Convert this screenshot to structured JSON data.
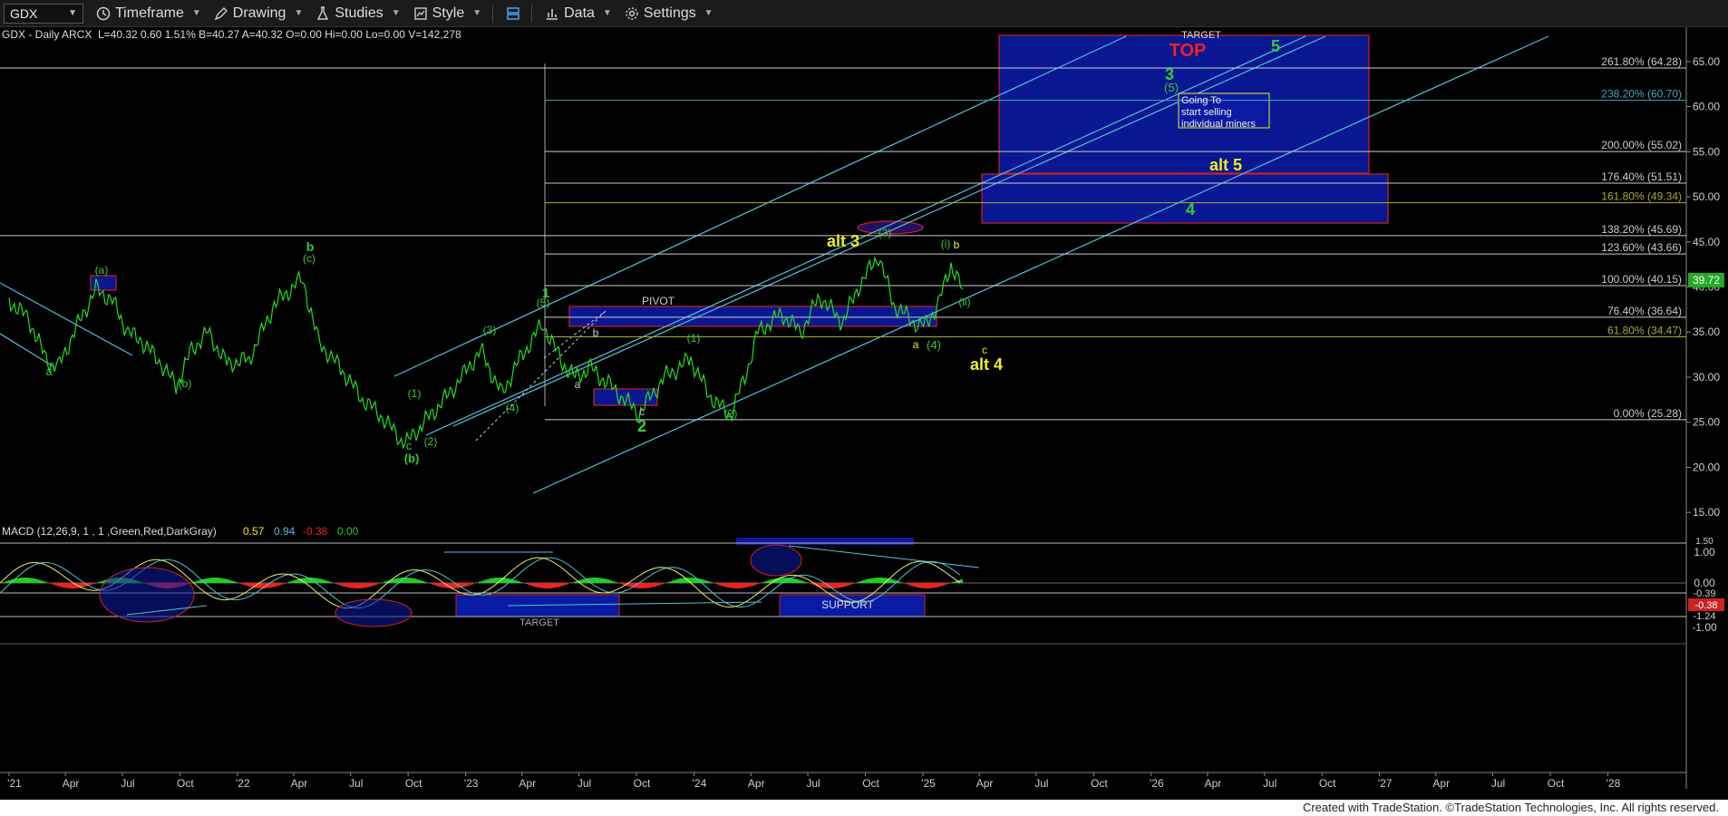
{
  "toolbar": {
    "symbol": "GDX",
    "timeframe": "Timeframe",
    "drawing": "Drawing",
    "studies": "Studies",
    "style": "Style",
    "data": "Data",
    "settings": "Settings"
  },
  "header": {
    "title": "GDX - Daily  ARCX",
    "stats": "L=40.32  0.60  1.51%  B=40.27  A=40.32  O=0.00  Hi=0.00  Lo=0.00  V=142,278"
  },
  "macd": {
    "label": "MACD (12,26,9, 1 , 1 ,Green,Red,DarkGray)",
    "v1": "0.57",
    "v2": "0.94",
    "v3": "-0.38",
    "v4": "0.00",
    "y_ticks": [
      "1.50",
      "1.00",
      "0.00",
      "-0.39",
      "-0.38",
      "-1.24",
      "-1.00"
    ],
    "support_label": "SUPPORT",
    "target_label": "TARGET"
  },
  "colors": {
    "price": "#22dd22",
    "fib": "#cccccc",
    "channel": "#4fc3d8",
    "box_fill": "#0b1aa3",
    "box_border": "#cc2222",
    "wave_green": "#33cc33",
    "wave_yellow": "#eeee22",
    "macd_hist_pos": "#22cc22",
    "macd_hist_neg": "#ee2222"
  },
  "chart_data": {
    "type": "line",
    "title": "GDX - Daily",
    "y_axis": {
      "min": 12,
      "max": 68,
      "ticks": [
        15,
        20,
        25,
        30,
        35,
        40,
        45,
        50,
        55,
        60,
        65
      ]
    },
    "x_labels": [
      "'21",
      "Apr",
      "Jul",
      "Oct",
      "'22",
      "Apr",
      "Jul",
      "Oct",
      "'23",
      "Apr",
      "Jul",
      "Oct",
      "'24",
      "Apr",
      "Jul",
      "Oct",
      "'25",
      "Apr",
      "Jul",
      "Oct",
      "'26",
      "Apr",
      "Jul",
      "Oct",
      "'27",
      "Apr",
      "Jul",
      "Oct",
      "'28"
    ],
    "last_price": 39.72,
    "price_series": [
      [
        "2021-01-01",
        38.5
      ],
      [
        "2021-02-01",
        36.5
      ],
      [
        "2021-03-01",
        32.0
      ],
      [
        "2021-03-20",
        31.0
      ],
      [
        "2021-04-15",
        35.0
      ],
      [
        "2021-05-20",
        39.8
      ],
      [
        "2021-06-15",
        38.5
      ],
      [
        "2021-07-10",
        35.0
      ],
      [
        "2021-08-01",
        34.0
      ],
      [
        "2021-09-01",
        31.5
      ],
      [
        "2021-09-25",
        29.0
      ],
      [
        "2021-10-20",
        33.0
      ],
      [
        "2021-11-15",
        35.0
      ],
      [
        "2021-12-15",
        31.5
      ],
      [
        "2022-01-20",
        32.0
      ],
      [
        "2022-03-01",
        38.0
      ],
      [
        "2022-04-15",
        41.0
      ],
      [
        "2022-05-10",
        34.0
      ],
      [
        "2022-06-15",
        31.0
      ],
      [
        "2022-07-20",
        27.5
      ],
      [
        "2022-08-15",
        26.0
      ],
      [
        "2022-09-26",
        22.5
      ],
      [
        "2022-10-20",
        24.5
      ],
      [
        "2022-11-15",
        26.5
      ],
      [
        "2022-12-10",
        28.5
      ],
      [
        "2023-01-25",
        33.0
      ],
      [
        "2023-02-28",
        28.0
      ],
      [
        "2023-03-20",
        31.0
      ],
      [
        "2023-05-04",
        36.0
      ],
      [
        "2023-06-05",
        31.5
      ],
      [
        "2023-06-25",
        30.0
      ],
      [
        "2023-07-20",
        31.0
      ],
      [
        "2023-08-20",
        29.0
      ],
      [
        "2023-10-05",
        26.0
      ],
      [
        "2023-11-15",
        30.0
      ],
      [
        "2023-12-27",
        32.0
      ],
      [
        "2024-01-25",
        28.0
      ],
      [
        "2024-02-28",
        25.7
      ],
      [
        "2024-03-25",
        30.5
      ],
      [
        "2024-04-12",
        35.0
      ],
      [
        "2024-05-20",
        37.0
      ],
      [
        "2024-06-20",
        35.0
      ],
      [
        "2024-07-20",
        39.0
      ],
      [
        "2024-08-25",
        36.0
      ],
      [
        "2024-09-20",
        40.0
      ],
      [
        "2024-10-22",
        43.5
      ],
      [
        "2024-11-15",
        38.0
      ],
      [
        "2024-12-20",
        36.0
      ],
      [
        "2025-01-02",
        35.5
      ],
      [
        "2025-01-25",
        38.0
      ],
      [
        "2025-02-15",
        42.5
      ],
      [
        "2025-03-05",
        39.72
      ]
    ],
    "fib_levels": [
      {
        "label": "0.00% (25.28)",
        "value": 25.28
      },
      {
        "label": "61.80% (34.47)",
        "value": 34.47
      },
      {
        "label": "76.40% (36.64)",
        "value": 36.64
      },
      {
        "label": "100.00% (40.15)",
        "value": 40.15
      },
      {
        "label": "123.60% (43.66)",
        "value": 43.66
      },
      {
        "label": "138.20% (45.69)",
        "value": 45.69
      },
      {
        "label": "161.80% (49.34)",
        "value": 49.34
      },
      {
        "label": "176.40% (51.51)",
        "value": 51.51
      },
      {
        "label": "200.00% (55.02)",
        "value": 55.02
      },
      {
        "label": "238.20% (60.70)",
        "value": 60.7
      },
      {
        "label": "261.80% (64.28)",
        "value": 64.28
      }
    ],
    "annotations": {
      "pivot": "PIVOT",
      "target": "TARGET",
      "top": "TOP",
      "note": [
        "Going To",
        "start selling",
        "individual miners"
      ],
      "alt3": "alt 3",
      "alt4": "alt 4",
      "alt5": "alt 5",
      "waves": [
        "a",
        "(a)",
        "(b)",
        "b",
        "(c)",
        "c",
        "(b)",
        "(1)",
        "(2)",
        "(3)",
        "(4)",
        "(5)",
        "1",
        "a",
        "b",
        "c",
        "2",
        "(1)",
        "(2)",
        "(3)",
        "(4)",
        "a",
        "(i)",
        "b",
        "(ii)",
        "c",
        "3",
        "(5)",
        "4",
        "5"
      ]
    }
  },
  "footer": "Created with TradeStation. ©TradeStation Technologies, Inc. All rights reserved."
}
